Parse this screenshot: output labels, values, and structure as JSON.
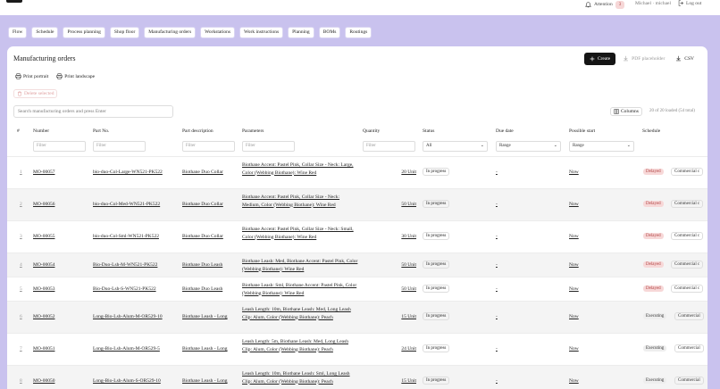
{
  "header": {
    "attention_label": "Attention",
    "attention_count": "3",
    "user": "Michael · michael",
    "logout": "Log out"
  },
  "nav": [
    "Flow",
    "Schedule",
    "Process planning",
    "Shop floor",
    "Manufacturing orders",
    "Workstations",
    "Work instructions",
    "Planning",
    "BOMs",
    "Routings"
  ],
  "page": {
    "title": "Manufacturing orders",
    "create": "Create",
    "pdf": "PDF placeholder",
    "csv": "CSV",
    "print_portrait": "Print portrait",
    "print_landscape": "Print landscape",
    "delete_selected": "Delete selected",
    "search_placeholder": "Search manufacturing orders and press Enter",
    "columns": "Columns",
    "loaded": "20 of 20 loaded (54 total)"
  },
  "table": {
    "headers": [
      "#",
      "Number",
      "Part No.",
      "Part description",
      "Parameters",
      "Quantity",
      "Status",
      "Due date",
      "Possible start",
      "Schedule"
    ],
    "filters": {
      "number": "Filter",
      "part_no": "Filter",
      "part_desc": "Filter",
      "params": "Filter",
      "quantity": "Filter",
      "status": "All",
      "due": "Range",
      "start": "Range"
    },
    "rows": [
      {
        "idx": "1",
        "number": "MO-00057",
        "part_no": "bio-duo-Col-Large-WN521-PK522",
        "desc": "Biothane Duo Collar",
        "params": "Biothane Accent: Pastel Pink, Collar Size - Neck: Large, Color (Webbing Biothane): Wine Red",
        "qty": "20 Unit",
        "status": "In progress",
        "due": "-",
        "start": "Now",
        "badge": "Delayed",
        "sched": "Commercial c"
      },
      {
        "idx": "2",
        "number": "MO-00056",
        "part_no": "bio-duo-Col-Med-WN521-PK522",
        "desc": "Biothane Duo Collar",
        "params": "Biothane Accent: Pastel Pink, Collar Size - Neck: Medium, Color (Webbing Biothane): Wine Red",
        "qty": "50 Unit",
        "status": "In progress",
        "due": "-",
        "start": "Now",
        "badge": "Delayed",
        "sched": "Commercial c"
      },
      {
        "idx": "3",
        "number": "MO-00055",
        "part_no": "bio-duo-Col-Sml-WN521-PK522",
        "desc": "Biothane Duo Collar",
        "params": "Biothane Accent: Pastel Pink, Collar Size - Neck: Small, Color (Webbing Biothane): Wine Red",
        "qty": "30 Unit",
        "status": "In progress",
        "due": "-",
        "start": "Now",
        "badge": "Delayed",
        "sched": "Commercial c"
      },
      {
        "idx": "4",
        "number": "MO-00054",
        "part_no": "Bio-Duo-Lsh-M-WN521-PK522",
        "desc": "Biothane Duo Leash",
        "params": "Biothane Leash: Med, Biothane Accent: Pastel Pink, Color (Webbing Biothane): Wine Red",
        "qty": "50 Unit",
        "status": "In progress",
        "due": "-",
        "start": "Now",
        "badge": "Delayed",
        "sched": "Commercial c"
      },
      {
        "idx": "5",
        "number": "MO-00053",
        "part_no": "Bio-Duo-Lsh-S-WN521-PK522",
        "desc": "Biothane Duo Leash",
        "params": "Biothane Leash: Sml, Biothane Accent: Pastel Pink, Color (Webbing Biothane): Wine Red",
        "qty": "50 Unit",
        "status": "In progress",
        "due": "-",
        "start": "Now",
        "badge": "Delayed",
        "sched": "Commercial c"
      },
      {
        "idx": "6",
        "number": "MO-00052",
        "part_no": "Long-Bio-Lsh-Alum-M-OR529-10",
        "desc": "Biothane Leash - Long",
        "params": "Leash Length: 10m, Biothane Leash: Med, Long Leash Clip: Alum, Color (Webbing Biothane): Peach",
        "qty": "15 Unit",
        "status": "In progress",
        "due": "-",
        "start": "Now",
        "badge": "Executing",
        "sched": "Commercial"
      },
      {
        "idx": "7",
        "number": "MO-00051",
        "part_no": "Long-Bio-Lsh-Alum-M-OR529-5",
        "desc": "Biothane Leash - Long",
        "params": "Leash Length: 5m, Biothane Leash: Med, Long Leash Clip: Alum, Color (Webbing Biothane): Peach",
        "qty": "24 Unit",
        "status": "In progress",
        "due": "-",
        "start": "Now",
        "badge": "Executing",
        "sched": "Commercial"
      },
      {
        "idx": "8",
        "number": "MO-00050",
        "part_no": "Long-Bio-Lsh-Alum-S-OR529-10",
        "desc": "Biothane Leash - Long",
        "params": "Leash Length: 10m, Biothane Leash: Sml, Long Leash Clip: Alum, Color (Webbing Biothane): Peach",
        "qty": "15 Unit",
        "status": "In progress",
        "due": "-",
        "start": "Now",
        "badge": "Executing",
        "sched": "Commercial"
      }
    ]
  },
  "colors": {
    "page_bg": "#c9c2ee",
    "accent_dark": "#151515",
    "delayed_bg": "#f7d8d8",
    "delayed_fg": "#b04040"
  },
  "icons": [
    "bell-icon",
    "logout-icon",
    "plus-icon",
    "download-icon",
    "printer-icon",
    "trash-icon",
    "columns-icon",
    "chevron-down-icon"
  ]
}
